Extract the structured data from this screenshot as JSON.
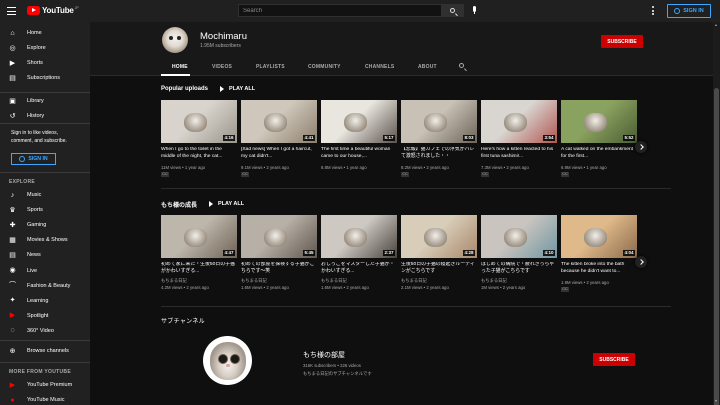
{
  "topbar": {
    "logo_text": "YouTube",
    "logo_region": "JP",
    "search_placeholder": "Search",
    "sign_in_label": "SIGN IN"
  },
  "sidebar": {
    "items": [
      {
        "label": "Home",
        "icon": "home-icon"
      },
      {
        "label": "Explore",
        "icon": "compass-icon"
      },
      {
        "label": "Shorts",
        "icon": "shorts-icon"
      },
      {
        "label": "Subscriptions",
        "icon": "subscriptions-icon"
      },
      {
        "label": "Library",
        "icon": "library-icon"
      },
      {
        "label": "History",
        "icon": "history-icon"
      }
    ],
    "signin_prompt": "Sign in to like videos, comment, and subscribe.",
    "signin_label": "SIGN IN",
    "explore_heading": "EXPLORE",
    "explore_items": [
      {
        "label": "Music",
        "icon": "music-icon"
      },
      {
        "label": "Sports",
        "icon": "trophy-icon"
      },
      {
        "label": "Gaming",
        "icon": "gamepad-icon"
      },
      {
        "label": "Movies & Shows",
        "icon": "film-icon"
      },
      {
        "label": "News",
        "icon": "news-icon"
      },
      {
        "label": "Live",
        "icon": "live-icon"
      },
      {
        "label": "Fashion & Beauty",
        "icon": "hanger-icon"
      },
      {
        "label": "Learning",
        "icon": "bulb-icon"
      },
      {
        "label": "Spotlight",
        "icon": "spotlight-icon"
      },
      {
        "label": "360° Video",
        "icon": "360-icon"
      }
    ],
    "browse_channels": "Browse channels",
    "more_heading": "MORE FROM YOUTUBE",
    "more_items": [
      {
        "label": "YouTube Premium",
        "icon": "youtube-premium-icon"
      },
      {
        "label": "YouTube Music",
        "icon": "youtube-music-icon"
      }
    ]
  },
  "channel": {
    "name": "Mochimaru",
    "subscribers": "1.95M subscribers",
    "subscribe_label": "SUBSCRIBE",
    "tabs": [
      "HOME",
      "VIDEOS",
      "PLAYLISTS",
      "COMMUNITY",
      "CHANNELS",
      "ABOUT"
    ],
    "active_tab": "HOME"
  },
  "popular": {
    "title": "Popular uploads",
    "play_all": "PLAY ALL",
    "videos": [
      {
        "title": "When I go to the toilet in the middle of the night, the cat...",
        "meta": "11M views • 1 year ago",
        "duration": "4:16",
        "cc": "CC",
        "c1": "#d8d4cd",
        "c2": "#9a948a"
      },
      {
        "title": "[Sad news] When I got a haircut, my cat didn't...",
        "meta": "9.1M views • 2 years ago",
        "duration": "4:41",
        "cc": "CC",
        "c1": "#cfc7bb",
        "c2": "#8c7e6c"
      },
      {
        "title": "The first time a beautiful woman came to our house,...",
        "meta": "8.8M views • 1 year ago",
        "duration": "5:17",
        "cc": "",
        "c1": "#e9e5df",
        "c2": "#5a524b"
      },
      {
        "title": "【悲報】猫カフェでの浮気がバレて激怒されました・・",
        "meta": "8.2M views • 2 years ago",
        "duration": "8:03",
        "cc": "CC",
        "c1": "#c7c1b6",
        "c2": "#6d6457"
      },
      {
        "title": "Here's how a kitten reacted to his first tuna sashimi!...",
        "meta": "7.3M views • 2 years ago",
        "duration": "3:54",
        "cc": "CC",
        "c1": "#d9d6d2",
        "c2": "#b0564f"
      },
      {
        "title": "A cat walked on the embankment for the first...",
        "meta": "6.9M views • 1 year ago",
        "duration": "5:52",
        "cc": "CC",
        "c1": "#8aa25f",
        "c2": "#4a5b33"
      }
    ]
  },
  "growth": {
    "title": "もち様の成長",
    "play_all": "PLAY ALL",
    "videos": [
      {
        "title": "初めて家に来た・生後50日の子猫がかわいすぎる...",
        "meta": "4.2M views • 2 years ago",
        "duration": "4:47",
        "channel_line": "もちまる日記",
        "c1": "#bdb6ab",
        "c2": "#6e6254"
      },
      {
        "title": "初めての部屋を探検する子猫がこちらです〜笑",
        "meta": "1.6M views • 2 years ago",
        "duration": "5:45",
        "channel_line": "もちまる日記",
        "c1": "#b7b0a7",
        "c2": "#5f564d"
      },
      {
        "title": "おしっこをマスターした子猫が・かわいすぎる...",
        "meta": "1.6M views • 2 years ago",
        "duration": "2:37",
        "channel_line": "もちまる日記",
        "c1": "#cdc8c1",
        "c2": "#48423c"
      },
      {
        "title": "生後50日の子猫の寝起きルーティンがこちらです",
        "meta": "2.1M views • 2 years ago",
        "duration": "4:28",
        "channel_line": "もちまる日記",
        "c1": "#d8cdb8",
        "c2": "#a8876a"
      },
      {
        "title": "はじめての病院で・疲れきっちゃった子猫がこちらです",
        "meta": "1M views • 2 years ago",
        "duration": "4:10",
        "channel_line": "もちまる日記",
        "c1": "#c9c4bf",
        "c2": "#6f96a2"
      },
      {
        "title": "The kitten broke into the bath because he didn't want to...",
        "meta": "1.9M views • 2 years ago",
        "duration": "4:04",
        "cc": "CC",
        "c1": "#e0b98a",
        "c2": "#8a6a4b"
      }
    ]
  },
  "sub_channels": {
    "title": "サブチャンネル",
    "channel": {
      "name": "もち様の部屋",
      "meta": "316K subscribers • 226 videos",
      "description": "もちまる日記のサブチャンネルです",
      "subscribe_label": "SUBSCRIBE"
    }
  }
}
